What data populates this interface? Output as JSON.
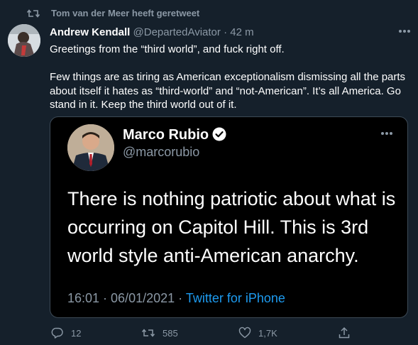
{
  "retweet_banner": {
    "text": "Tom van der Meer heeft geretweet"
  },
  "tweet": {
    "author_name": "Andrew Kendall",
    "author_handle": "@DepartedAviator",
    "separator": "·",
    "time": "42 m",
    "paragraph_1": "Greetings from the “third world”, and fuck right off.",
    "paragraph_2": "Few things are as tiring as American exceptionalism dismissing all the parts about itself it hates as “third-world” and “not-American”. It’s all America. Go stand in it. Keep the third world out of it."
  },
  "embedded": {
    "name": "Marco Rubio",
    "handle": "@marcorubio",
    "text": "There is nothing patriotic about what is occurring on Capitol Hill. This is 3rd world style anti-American anarchy.",
    "timestamp": "16:01 · 06/01/2021 ·",
    "source": "Twitter for iPhone"
  },
  "actions": {
    "replies": "12",
    "retweets": "585",
    "likes": "1,7K"
  },
  "colors": {
    "background": "#15202b",
    "secondary_text": "#8b98a5",
    "link": "#1d9bf0"
  }
}
